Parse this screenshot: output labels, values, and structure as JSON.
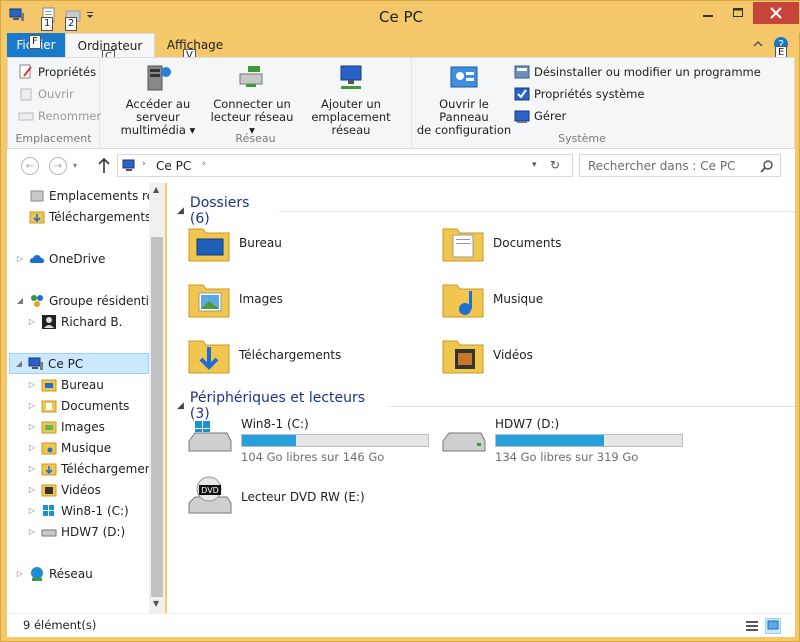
{
  "window": {
    "title": "Ce PC"
  },
  "qat": {
    "keytip1": "1",
    "keytip2": "2"
  },
  "tabs": {
    "file_label": "Fichier",
    "file_keytip": "F",
    "computer_label": "Ordinateur",
    "computer_keytip": "C",
    "view_label": "Affichage",
    "view_keytip": "V",
    "help_keytip": "E"
  },
  "ribbon": {
    "location": {
      "label": "Emplacement",
      "properties": "Propriétés",
      "open": "Ouvrir",
      "rename": "Renommer"
    },
    "network": {
      "label": "Réseau",
      "media_line1": "Accéder au serveur",
      "media_line2": "multimédia",
      "map_line1": "Connecter un",
      "map_line2": "lecteur réseau",
      "add_line1": "Ajouter un",
      "add_line2": "emplacement réseau"
    },
    "system": {
      "label": "Système",
      "panel_line1": "Ouvrir le Panneau",
      "panel_line2": "de configuration",
      "uninstall": "Désinstaller ou modifier un programme",
      "sysprops": "Propriétés système",
      "manage": "Gérer"
    }
  },
  "address": {
    "path": "Ce PC",
    "search_placeholder": "Rechercher dans : Ce PC"
  },
  "nav": {
    "recent": "Emplacements ré",
    "downloads_quick": "Téléchargements",
    "onedrive": "OneDrive",
    "homegroup": "Groupe résidentiel",
    "user": "Richard B.",
    "thispc": "Ce PC",
    "desktop": "Bureau",
    "documents": "Documents",
    "pictures": "Images",
    "music": "Musique",
    "downloads": "Téléchargements",
    "videos": "Vidéos",
    "drive_c": "Win8-1 (C:)",
    "drive_d": "HDW7 (D:)",
    "network": "Réseau"
  },
  "main": {
    "folders_header": "Dossiers (6)",
    "folders": [
      "Bureau",
      "Documents",
      "Images",
      "Musique",
      "Téléchargements",
      "Vidéos"
    ],
    "devices_header": "Périphériques et lecteurs (3)",
    "drives": [
      {
        "name": "Win8-1 (C:)",
        "free": "104 Go libres sur 146 Go",
        "used_fraction": 0.29
      },
      {
        "name": "HDW7 (D:)",
        "free": "134 Go libres sur 319 Go",
        "used_fraction": 0.58
      }
    ],
    "dvd": {
      "name": "Lecteur DVD RW (E:)",
      "label": "DVD"
    }
  },
  "status": {
    "count": "9 élément(s)"
  },
  "colors": {
    "accent": "#1979ca",
    "titlebar": "#f4c76b",
    "progress": "#26a0da",
    "close": "#c7453a"
  }
}
